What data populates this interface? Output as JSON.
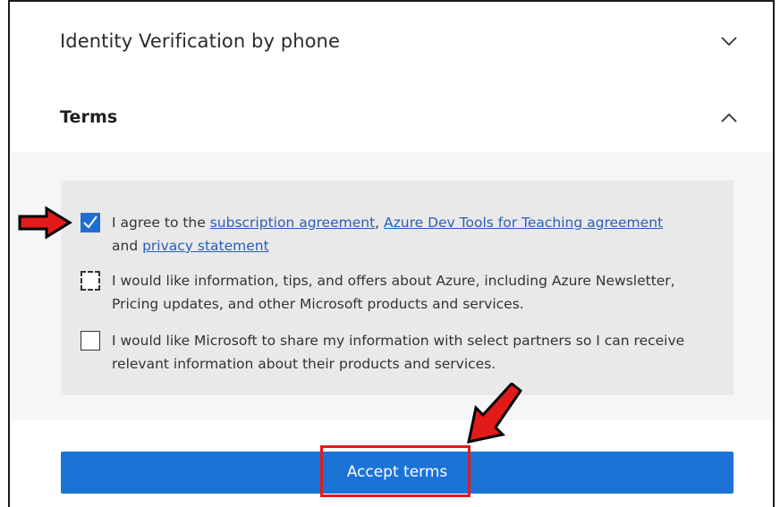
{
  "accordion": {
    "identity_title": "Identity Verification by phone",
    "terms_title": "Terms"
  },
  "options": {
    "agree": {
      "prefix": "I agree to the ",
      "link1": "subscription agreement",
      "sep": ", ",
      "link2": "Azure Dev Tools for Teaching agreement",
      "mid": "and ",
      "link3": "privacy statement",
      "checked": true
    },
    "info": {
      "text": "I would like information, tips, and offers about Azure, including Azure Newsletter, Pricing updates, and other Microsoft products and services.",
      "checked": false
    },
    "share": {
      "text": "I would like Microsoft to share my information with select partners so I can receive relevant information about their products and services.",
      "checked": false
    }
  },
  "accept_button_label": "Accept terms",
  "colors": {
    "accent": "#1b73d8",
    "annotation": "#e31a1a"
  }
}
